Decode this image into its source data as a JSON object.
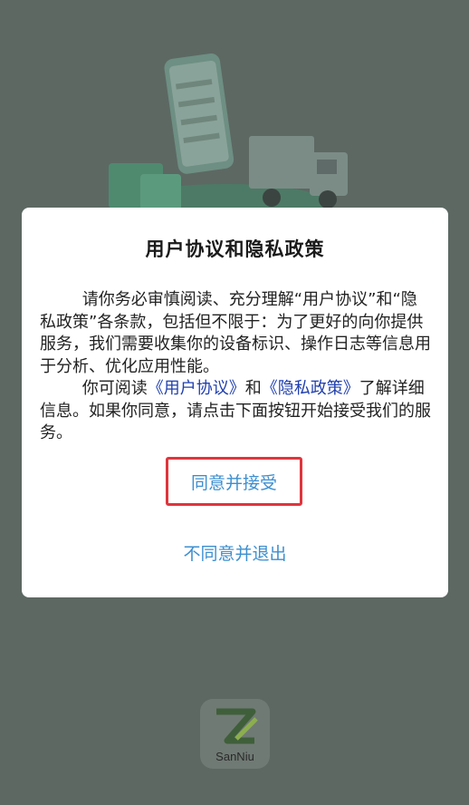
{
  "dialog": {
    "title": "用户协议和隐私政策",
    "paragraph1": "请你务必审慎阅读、充分理解“用户协议”和“隐私政策”各条款，包括但不限于：为了更好的向你提供服务，我们需要收集你的设备标识、操作日志等信息用于分析、优化应用性能。",
    "paragraph2_prefix": "你可阅读",
    "user_agreement_link": "《用户协议》",
    "paragraph2_and": "和",
    "privacy_policy_link": "《隐私政策》",
    "paragraph2_suffix": "了解详细信息。如果你同意，请点击下面按钮开始接受我们的服务。",
    "agree_label": "同意并接受",
    "disagree_label": "不同意并退出"
  },
  "app_logo": {
    "text": "SanNiu"
  },
  "colors": {
    "overlay": "#5d6863",
    "link": "#1f3fae",
    "button_text": "#3d8fd0",
    "highlight_border": "#e0353d"
  }
}
